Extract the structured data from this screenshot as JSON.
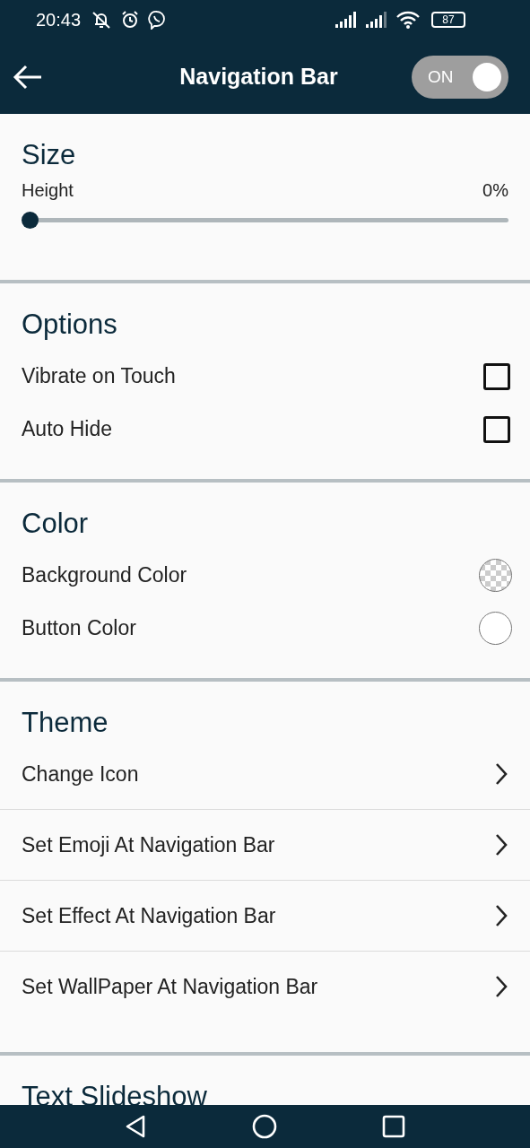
{
  "status_bar": {
    "time": "20:43",
    "battery": "87"
  },
  "header": {
    "title": "Navigation Bar",
    "toggle": {
      "label": "ON",
      "on": true
    }
  },
  "sections": [
    {
      "title": "Size",
      "items": [
        {
          "kind": "slider",
          "label": "Height",
          "reading": "0%",
          "level": 0
        }
      ]
    },
    {
      "title": "Options",
      "items": [
        {
          "kind": "checkbox",
          "label": "Vibrate on Touch",
          "checked": false
        },
        {
          "kind": "checkbox",
          "label": "Auto Hide",
          "checked": false
        }
      ]
    },
    {
      "title": "Color",
      "items": [
        {
          "kind": "swatch",
          "label": "Background Color",
          "transparent": true
        },
        {
          "kind": "swatch",
          "label": "Button Color",
          "transparent": false,
          "color": "#ffffff"
        }
      ]
    },
    {
      "title": "Theme",
      "items": [
        {
          "kind": "link",
          "label": "Change Icon"
        },
        {
          "kind": "link",
          "label": "Set Emoji At Navigation Bar"
        },
        {
          "kind": "link",
          "label": "Set Effect At Navigation Bar"
        },
        {
          "kind": "link",
          "label": "Set WallPaper At Navigation Bar"
        }
      ]
    },
    {
      "title": "Text Slideshow"
    }
  ]
}
